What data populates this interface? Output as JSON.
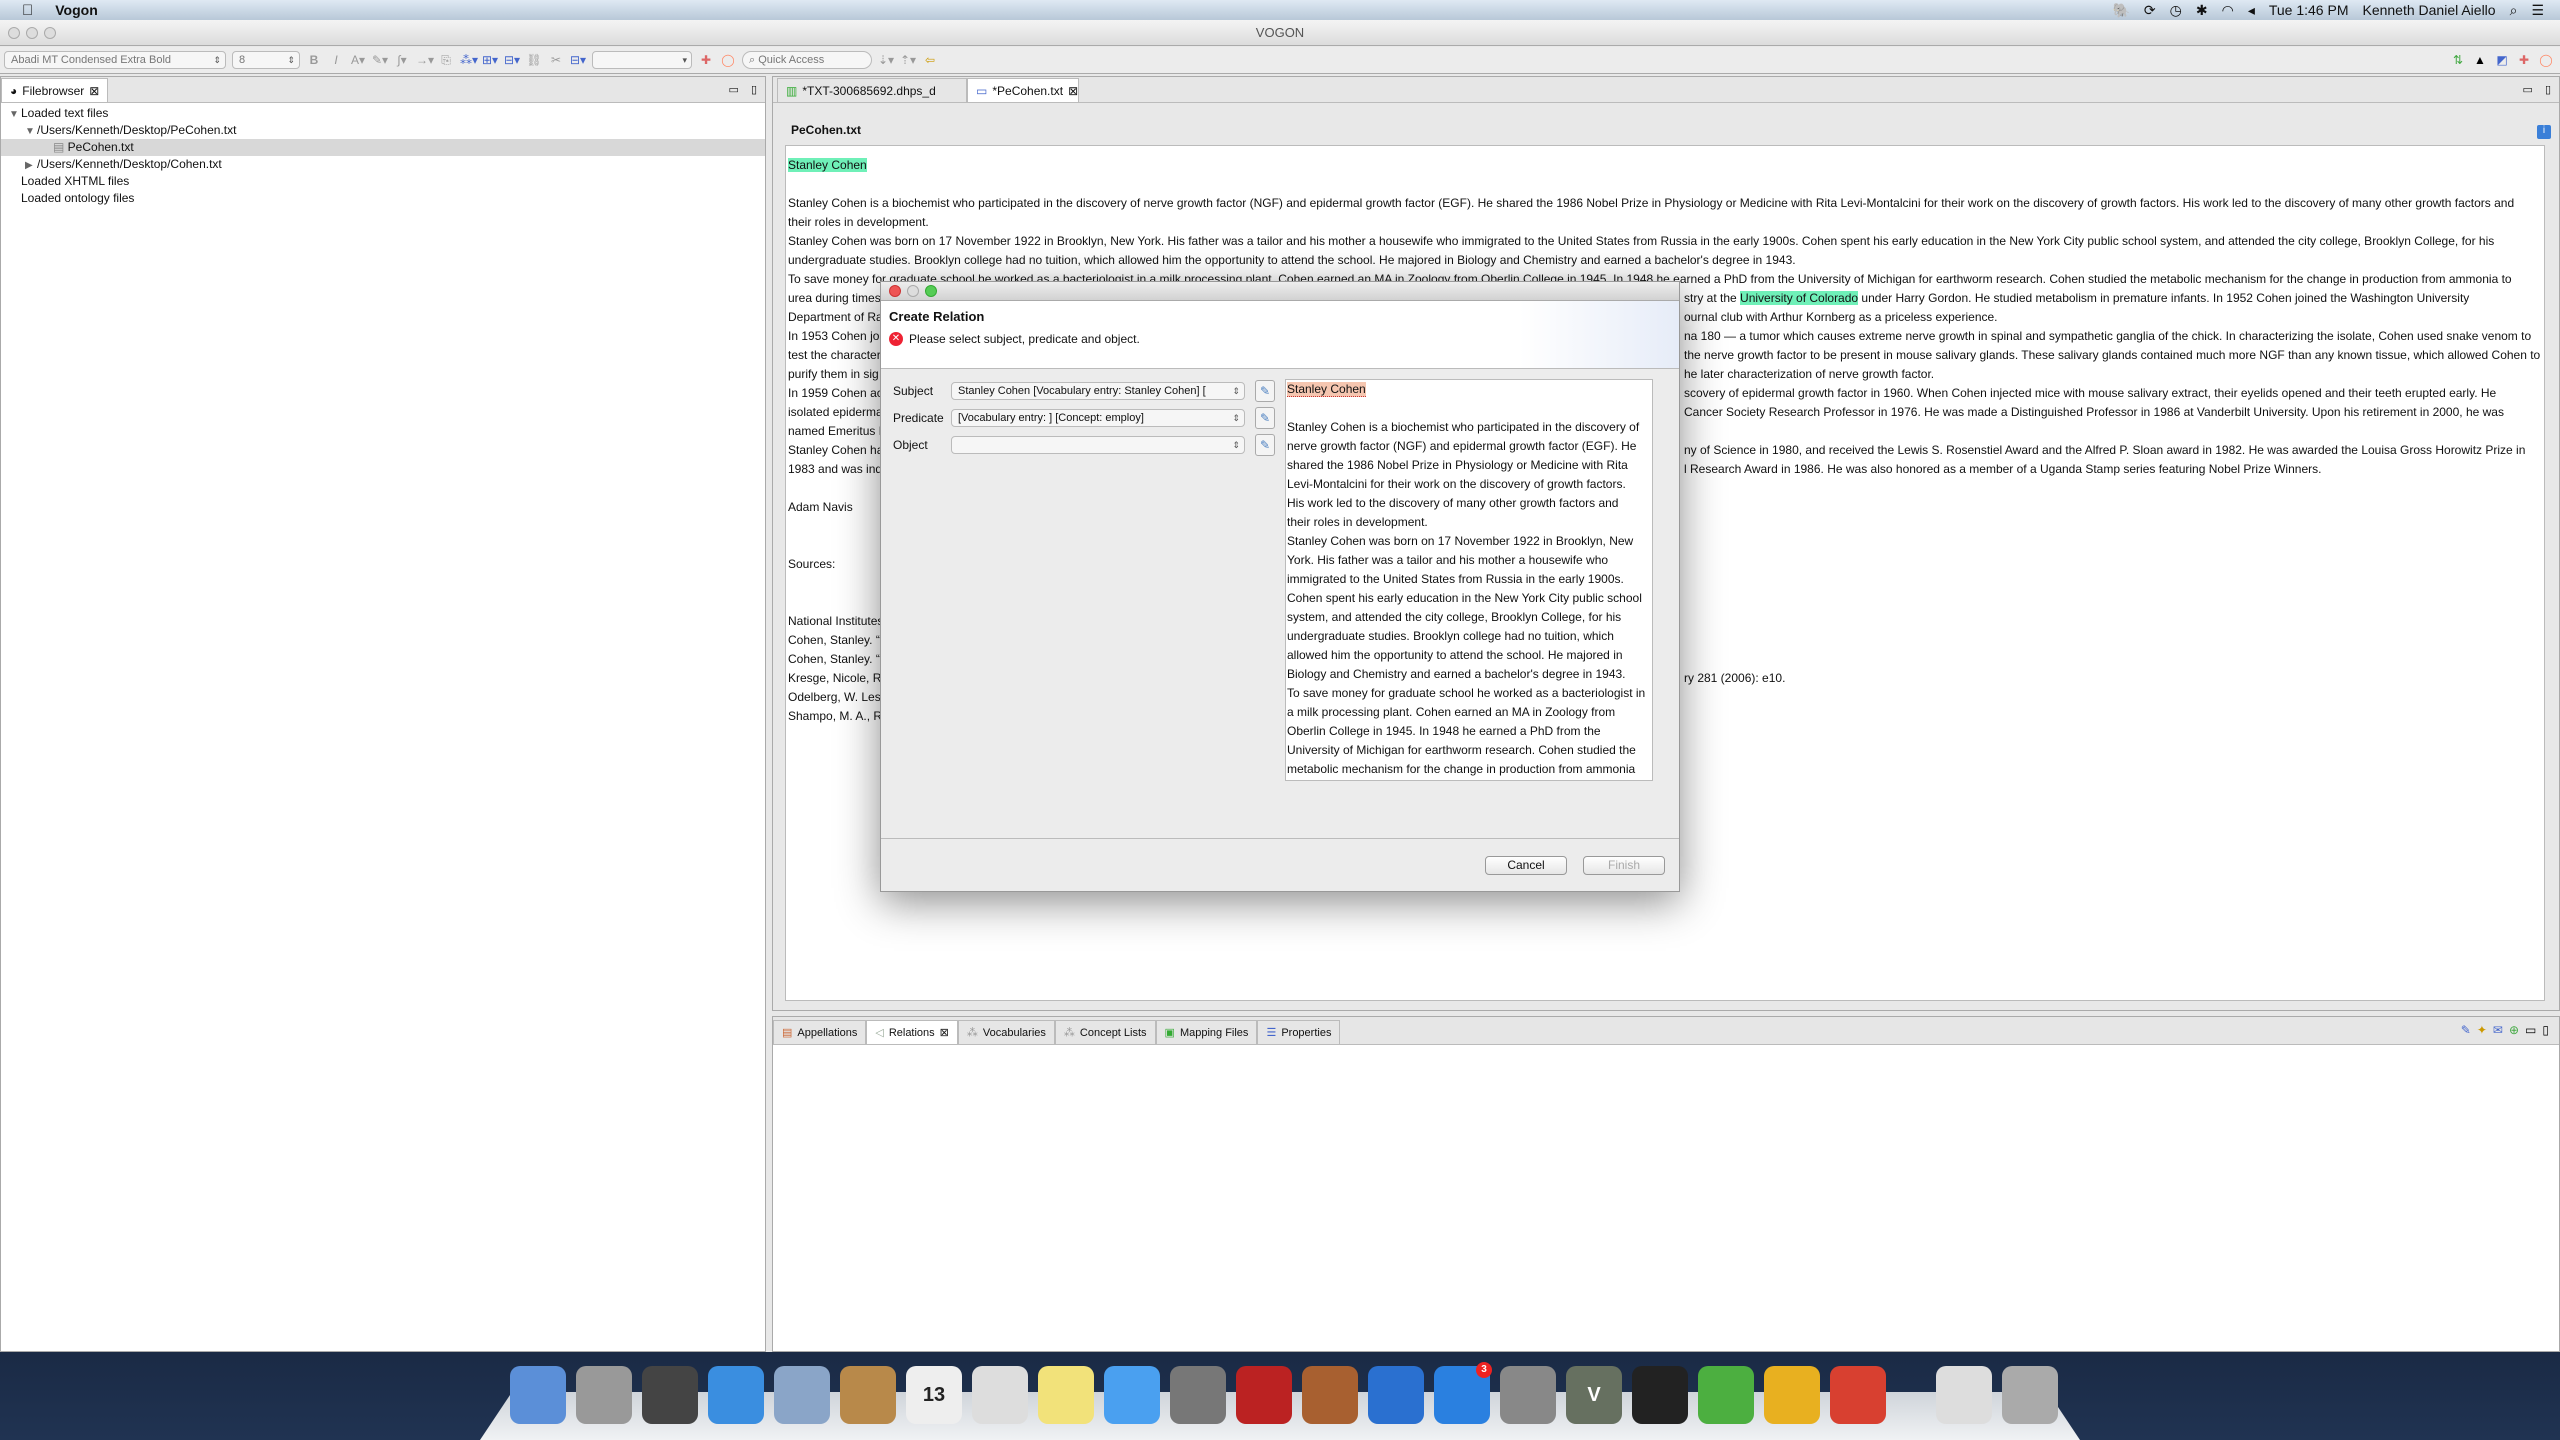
{
  "menubar": {
    "app": "Vogon",
    "clock": "Tue 1:46 PM",
    "user": "Kenneth Daniel Aiello",
    "status_icons": [
      "evernote-icon",
      "sync-icon",
      "time-machine-icon",
      "bluetooth-icon",
      "wifi-icon",
      "volume-icon",
      "spotlight-icon",
      "notification-center-icon"
    ]
  },
  "window": {
    "title": "VOGON"
  },
  "toolbar": {
    "font": "Abadi MT Condensed Extra Bold",
    "size": "8",
    "quick_access": "Quick Access"
  },
  "filebrowser": {
    "tab": "Filebrowser",
    "tree": [
      {
        "label": "Loaded text files",
        "level": 0,
        "toggle": "▼"
      },
      {
        "label": "/Users/Kenneth/Desktop/PeCohen.txt",
        "level": 1,
        "toggle": "▼"
      },
      {
        "label": "PeCohen.txt",
        "level": 2,
        "toggle": "",
        "selected": true
      },
      {
        "label": "/Users/Kenneth/Desktop/Cohen.txt",
        "level": 1,
        "toggle": "▶"
      },
      {
        "label": "Loaded XHTML files",
        "level": 0,
        "toggle": ""
      },
      {
        "label": "Loaded ontology files",
        "level": 0,
        "toggle": ""
      }
    ]
  },
  "editor": {
    "tabs": [
      "*TXT-300685692.dhps_d",
      "*PeCohen.txt"
    ],
    "active_tab": 1,
    "doc_title": "PeCohen.txt",
    "highlight_color": "#6ff0b8",
    "lines": [
      {
        "l": "Stanley Cohen",
        "hl": true
      },
      {
        "l": ""
      },
      {
        "l": "Stanley Cohen is a biochemist who participated in the discovery of nerve growth factor (NGF) and epidermal growth factor (EGF).  He shared the 1986 Nobel Prize in Physiology or Medicine with Rita Levi-Montalcini for their work on the discovery of growth factors.  His work led to the discovery of many other growth factors and"
      },
      {
        "l": "their roles in development."
      },
      {
        "l": "Stanley Cohen was born on 17 November 1922 in Brooklyn, New York.  His father was a tailor and his mother a housewife who immigrated to the United States from Russia in the early 1900s.  Cohen spent his early education in the New York City public school system, and attended the city college, Brooklyn College, for his"
      },
      {
        "l": "undergraduate studies.  Brooklyn college had no tuition, which allowed him the opportunity to attend the school.   He majored in Biology and Chemistry and earned a bachelor's degree in 1943."
      },
      {
        "l": "To save money for graduate school he worked as a bacteriologist in a milk processing plant.  Cohen earned an MA in Zoology from Oberlin College in 1945.  In 1948 he earned a PhD from the University of Michigan for earthworm research.  Cohen studied the metabolic mechanism for the change in production from ammonia to"
      },
      {
        "l": "urea during times",
        "r1": "stry at the ",
        "rh": "University of Colorado",
        "r2": " under Harry Gordon.  He studied metabolism in premature infants.  In 1952 Cohen joined the Washington University"
      },
      {
        "l": "Department of Ra",
        "r2": "ournal club with Arthur Kornberg as a priceless experience."
      },
      {
        "l": "In 1953 Cohen joi",
        "r2": "na 180 — a tumor which causes extreme nerve growth in spinal and sympathetic ganglia of the chick.  In characterizing the isolate, Cohen used snake venom to"
      },
      {
        "l": "test the characteri",
        "r2": " the nerve growth factor to be present in mouse salivary glands.  These salivary glands contained much more NGF than any known tissue, which allowed Cohen to"
      },
      {
        "l": "purify them in sig",
        "r2": "he later characterization of nerve growth factor."
      },
      {
        "l": "In 1959 Cohen ac",
        "r2": "scovery of epidermal growth factor in 1960.  When Cohen injected mice with mouse salivary extract, their eyelids opened and their teeth erupted early.  He"
      },
      {
        "l": "isolated epiderma",
        "r2": " Cancer Society Research Professor in 1976.  He was made a Distinguished Professor in 1986 at Vanderbilt University.  Upon his retirement in 2000, he was"
      },
      {
        "l": "named Emeritus P"
      },
      {
        "l": "Stanley Cohen has",
        "r2": "ny of Science in 1980, and received the Lewis S. Rosenstiel Award and the Alfred P. Sloan award in 1982.  He was awarded the Louisa Gross Horowitz Prize in"
      },
      {
        "l": "1983 and was ind",
        "r2": "l Research Award in 1986.  He was also honored as a member of a Uganda Stamp series featuring Nobel Prize Winners."
      },
      {
        "l": ""
      },
      {
        "l": "Adam Navis"
      },
      {
        "l": ""
      },
      {
        "l": ""
      },
      {
        "l": "Sources:"
      },
      {
        "l": ""
      },
      {
        "l": ""
      },
      {
        "l": "National Institutes"
      },
      {
        "l": "Cohen, Stanley. “E"
      },
      {
        "l": "Cohen, Stanley.  “"
      },
      {
        "l": "Kresge, Nicole, Ro",
        "r2": "ry 281 (2006): e10."
      },
      {
        "l": "Odelberg, W.  Les"
      },
      {
        "l": "Shampo, M. A., R."
      }
    ]
  },
  "dialog": {
    "title": "Create Relation",
    "message": "Please select subject, predicate and object.",
    "fields": [
      {
        "label": "Subject",
        "value": "Stanley Cohen [Vocabulary entry: Stanley Cohen] ["
      },
      {
        "label": "Predicate",
        "value": "[Vocabulary entry: ]  [Concept: employ]"
      },
      {
        "label": "Object",
        "value": ""
      }
    ],
    "preview": [
      "Stanley Cohen",
      "",
      "Stanley Cohen is a biochemist who participated in the discovery of",
      "nerve growth factor (NGF) and epidermal growth factor (EGF).  He",
      "shared the 1986 Nobel Prize in Physiology or Medicine with Rita",
      "Levi-Montalcini for their work on the discovery of growth factors.",
      "His work led to the discovery of many other growth factors and",
      "their roles in development.",
      "Stanley Cohen was born on 17 November 1922 in Brooklyn, New",
      "York.  His father was a tailor and his mother a housewife who",
      "immigrated to the United States from Russia in the early 1900s.",
      "Cohen spent his early education in the New York City public school",
      "system, and attended the city college, Brooklyn College, for his",
      "undergraduate studies.  Brooklyn college had no tuition, which",
      "allowed him the opportunity to attend the school.   He majored in",
      "Biology and Chemistry and earned a bachelor's degree in 1943.",
      "To save money for graduate school he worked as a bacteriologist in",
      "a milk processing plant.  Cohen earned an MA in Zoology from",
      "Oberlin College in 1945.  In 1948 he earned a PhD from the",
      "University of Michigan for earthworm research.  Cohen studied the",
      "metabolic mechanism for the change in production from ammonia"
    ],
    "cancel": "Cancel",
    "finish": "Finish"
  },
  "bottom": {
    "tabs": [
      "Appellations",
      "Relations",
      "Vocabularies",
      "Concept Lists",
      "Mapping Files",
      "Properties"
    ],
    "active_tab": 1
  },
  "dock": [
    {
      "name": "finder",
      "c": "#5b8fd8"
    },
    {
      "name": "launchpad",
      "c": "#999"
    },
    {
      "name": "mission-control",
      "c": "#444"
    },
    {
      "name": "safari",
      "c": "#3a8ee0"
    },
    {
      "name": "mail",
      "c": "#8aa5c8"
    },
    {
      "name": "contacts",
      "c": "#b8894a"
    },
    {
      "name": "calendar",
      "c": "#eee",
      "t": "13"
    },
    {
      "name": "reminders",
      "c": "#ddd"
    },
    {
      "name": "notes",
      "c": "#f2e27a"
    },
    {
      "name": "messages",
      "c": "#4aa0f0"
    },
    {
      "name": "facetime",
      "c": "#777"
    },
    {
      "name": "photo-booth",
      "c": "#b22"
    },
    {
      "name": "iphoto",
      "c": "#a86030"
    },
    {
      "name": "itunes",
      "c": "#2a70d0"
    },
    {
      "name": "app-store",
      "c": "#2a80e0",
      "badge": "3"
    },
    {
      "name": "system-preferences",
      "c": "#888"
    },
    {
      "name": "vogon",
      "c": "#667060",
      "t": "V"
    },
    {
      "name": "terminal",
      "c": "#222"
    },
    {
      "name": "evernote",
      "c": "#4caf40"
    },
    {
      "name": "moneydance",
      "c": "#e8b020"
    },
    {
      "name": "chrome",
      "c": "#d84030"
    },
    {
      "name": "document",
      "c": "#ddd"
    },
    {
      "name": "trash",
      "c": "#aaa"
    }
  ]
}
